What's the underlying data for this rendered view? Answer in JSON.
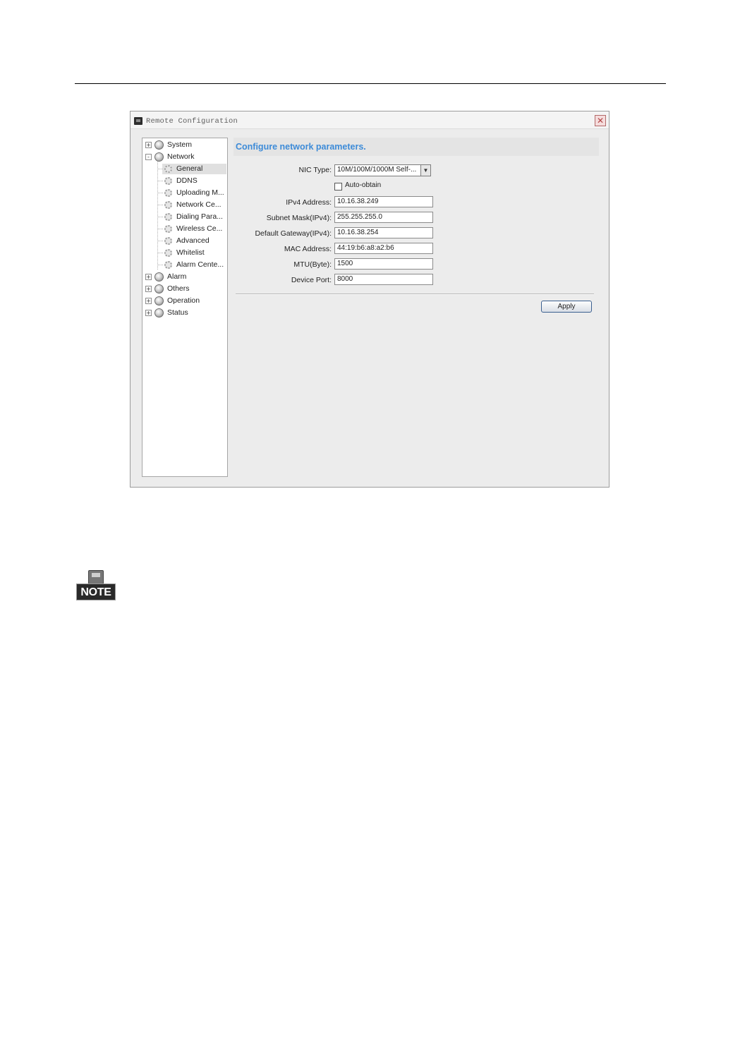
{
  "window": {
    "title": "Remote Configuration"
  },
  "tree": {
    "items": [
      {
        "label": "System",
        "level": 0,
        "expander": "+"
      },
      {
        "label": "Network",
        "level": 0,
        "expander": "-"
      },
      {
        "label": "General",
        "level": 1,
        "selected": true
      },
      {
        "label": "DDNS",
        "level": 1
      },
      {
        "label": "Uploading M...",
        "level": 1
      },
      {
        "label": "Network Ce...",
        "level": 1
      },
      {
        "label": "Dialing Para...",
        "level": 1
      },
      {
        "label": "Wireless Ce...",
        "level": 1
      },
      {
        "label": "Advanced",
        "level": 1
      },
      {
        "label": "Whitelist",
        "level": 1
      },
      {
        "label": "Alarm Cente...",
        "level": 1
      },
      {
        "label": "Alarm",
        "level": 0,
        "expander": "+"
      },
      {
        "label": "Others",
        "level": 0,
        "expander": "+"
      },
      {
        "label": "Operation",
        "level": 0,
        "expander": "+"
      },
      {
        "label": "Status",
        "level": 0,
        "expander": "+"
      }
    ]
  },
  "content": {
    "header": "Configure network parameters.",
    "nic_type_label": "NIC Type:",
    "nic_type_value": "10M/100M/1000M Self-...",
    "auto_obtain_label": "Auto-obtain",
    "fields": [
      {
        "label": "IPv4 Address:",
        "value": "10.16.38.249"
      },
      {
        "label": "Subnet Mask(IPv4):",
        "value": "255.255.255.0"
      },
      {
        "label": "Default Gateway(IPv4):",
        "value": "10.16.38.254"
      },
      {
        "label": "MAC Address:",
        "value": "44:19:b6:a8:a2:b6"
      },
      {
        "label": "MTU(Byte):",
        "value": "1500"
      },
      {
        "label": "Device Port:",
        "value": "8000"
      }
    ],
    "apply_label": "Apply"
  },
  "note": {
    "label": "NOTE"
  },
  "colors": {
    "header_text": "#3d8bd8",
    "window_bg": "#ececec"
  }
}
